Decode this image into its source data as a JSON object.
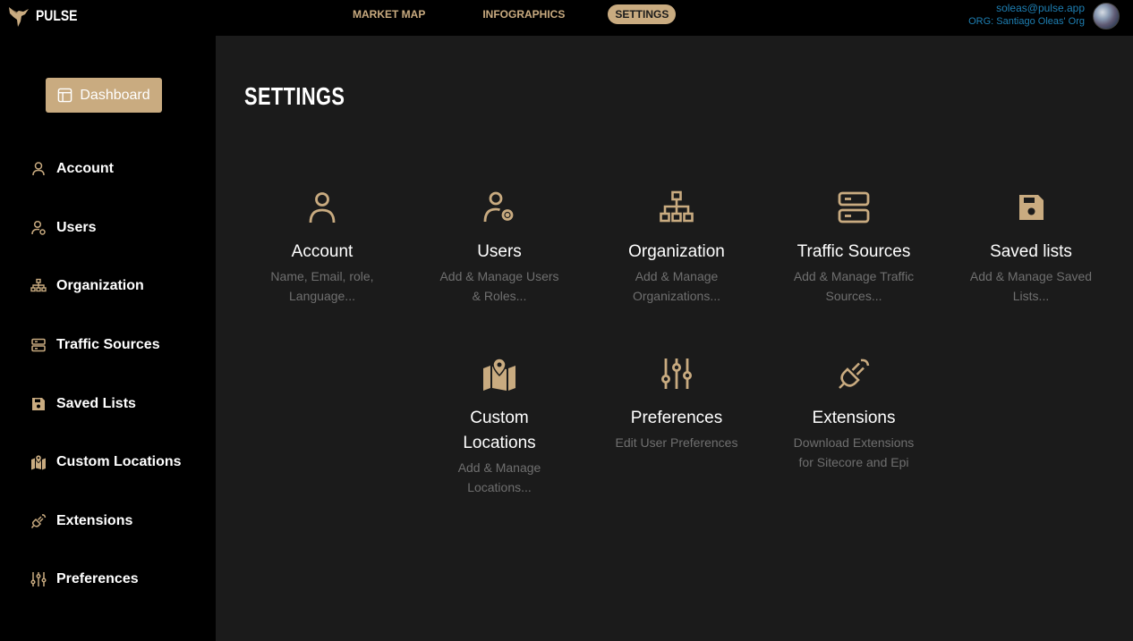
{
  "app": {
    "name": "PULSE"
  },
  "topnav": {
    "items": [
      {
        "label": "MARKET MAP"
      },
      {
        "label": "INFOGRAPHICS"
      },
      {
        "label": "SETTINGS",
        "active": true
      }
    ]
  },
  "user": {
    "email": "soleas@pulse.app",
    "org": "ORG: Santiago Oleas' Org"
  },
  "sidebar": {
    "dashboard_label": "Dashboard",
    "items": [
      {
        "label": "Account",
        "icon": "user-icon"
      },
      {
        "label": "Users",
        "icon": "user-cog-icon"
      },
      {
        "label": "Organization",
        "icon": "sitemap-icon"
      },
      {
        "label": "Traffic Sources",
        "icon": "server-icon"
      },
      {
        "label": "Saved Lists",
        "icon": "floppy-disk-icon"
      },
      {
        "label": "Custom Locations",
        "icon": "map-pin-icon"
      },
      {
        "label": "Extensions",
        "icon": "plug-icon"
      },
      {
        "label": "Preferences",
        "icon": "sliders-icon"
      }
    ]
  },
  "main": {
    "title": "SETTINGS",
    "cards": [
      {
        "title": "Account",
        "desc1": "Name, Email, role,",
        "desc2": "Language...",
        "icon": "user-icon"
      },
      {
        "title": "Users",
        "desc1": "Add & Manage Users",
        "desc2": "& Roles...",
        "icon": "user-cog-icon"
      },
      {
        "title": "Organization",
        "desc1": "Add & Manage",
        "desc2": "Organizations...",
        "icon": "sitemap-icon"
      },
      {
        "title": "Traffic Sources",
        "desc1": "Add & Manage Traffic",
        "desc2": "Sources...",
        "icon": "server-icon"
      },
      {
        "title": "Saved lists",
        "desc1": "Add & Manage Saved",
        "desc2": "Lists...",
        "icon": "floppy-disk-icon"
      },
      {
        "title1": "Custom",
        "title2": "Locations",
        "desc1": "Add & Manage",
        "desc2": "Locations...",
        "icon": "map-pin-icon"
      },
      {
        "title": "Preferences",
        "desc1": "Edit User Preferences",
        "icon": "sliders-icon"
      },
      {
        "title": "Extensions",
        "desc1": "Download Extensions",
        "desc2": "for Sitecore and Epi",
        "icon": "plug-icon"
      }
    ]
  },
  "colors": {
    "accent": "#c9ab80",
    "link": "#1e7fb3",
    "main_bg": "#1b1b1b",
    "muted_text": "#6f6f6f"
  }
}
